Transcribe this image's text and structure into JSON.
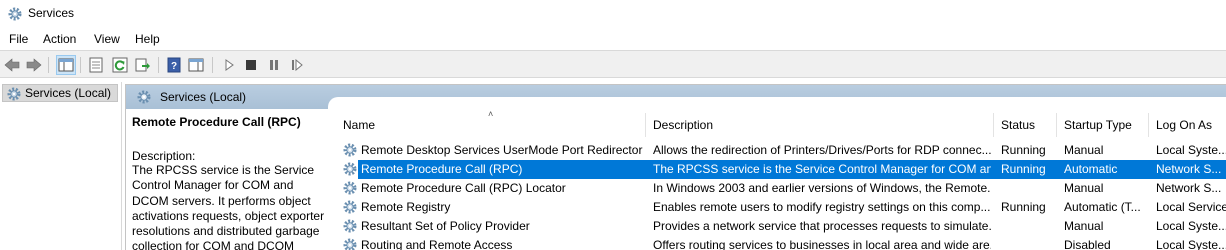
{
  "window": {
    "title": "Services",
    "icon": "gear-icon"
  },
  "menu": [
    "File",
    "Action",
    "View",
    "Help"
  ],
  "toolbar": {
    "icons": [
      "back-arrow-icon",
      "forward-arrow-icon",
      "console-tree-icon",
      "properties-icon",
      "refresh-icon",
      "export-list-icon",
      "help-icon",
      "show-hide-icon",
      "start-service-icon",
      "stop-service-icon",
      "pause-service-icon",
      "resume-service-icon"
    ]
  },
  "tree": {
    "selected": "Services (Local)"
  },
  "pane": {
    "header": "Services (Local)"
  },
  "detail": {
    "service_name": "Remote Procedure Call (RPC)",
    "description_label": "Description:",
    "description": "The RPCSS service is the Service Control Manager for COM and DCOM servers. It performs object activations requests, object exporter resolutions and distributed garbage collection for COM and DCOM"
  },
  "table": {
    "columns": [
      "Name",
      "Description",
      "Status",
      "Startup Type",
      "Log On As"
    ],
    "sort_column": "Name",
    "rows": [
      {
        "name": "Remote Desktop Services UserMode Port Redirector",
        "description": "Allows the redirection of Printers/Drives/Ports for RDP connec...",
        "status": "Running",
        "startup": "Manual",
        "logon": "Local Syste..."
      },
      {
        "name": "Remote Procedure Call (RPC)",
        "description": "The RPCSS service is the Service Control Manager for COM an...",
        "status": "Running",
        "startup": "Automatic",
        "logon": "Network S...",
        "selected": true
      },
      {
        "name": "Remote Procedure Call (RPC) Locator",
        "description": "In Windows 2003 and earlier versions of Windows, the Remote...",
        "status": "",
        "startup": "Manual",
        "logon": "Network S..."
      },
      {
        "name": "Remote Registry",
        "description": "Enables remote users to modify registry settings on this comp...",
        "status": "Running",
        "startup": "Automatic (T...",
        "logon": "Local Service"
      },
      {
        "name": "Resultant Set of Policy Provider",
        "description": "Provides a network service that processes requests to simulate...",
        "status": "",
        "startup": "Manual",
        "logon": "Local Syste..."
      },
      {
        "name": "Routing and Remote Access",
        "description": "Offers routing services to businesses in local area and wide are...",
        "status": "",
        "startup": "Disabled",
        "logon": "Local Syste..."
      }
    ]
  },
  "colors": {
    "selection": "#0078d7",
    "pane_header": "#b9cde0"
  }
}
